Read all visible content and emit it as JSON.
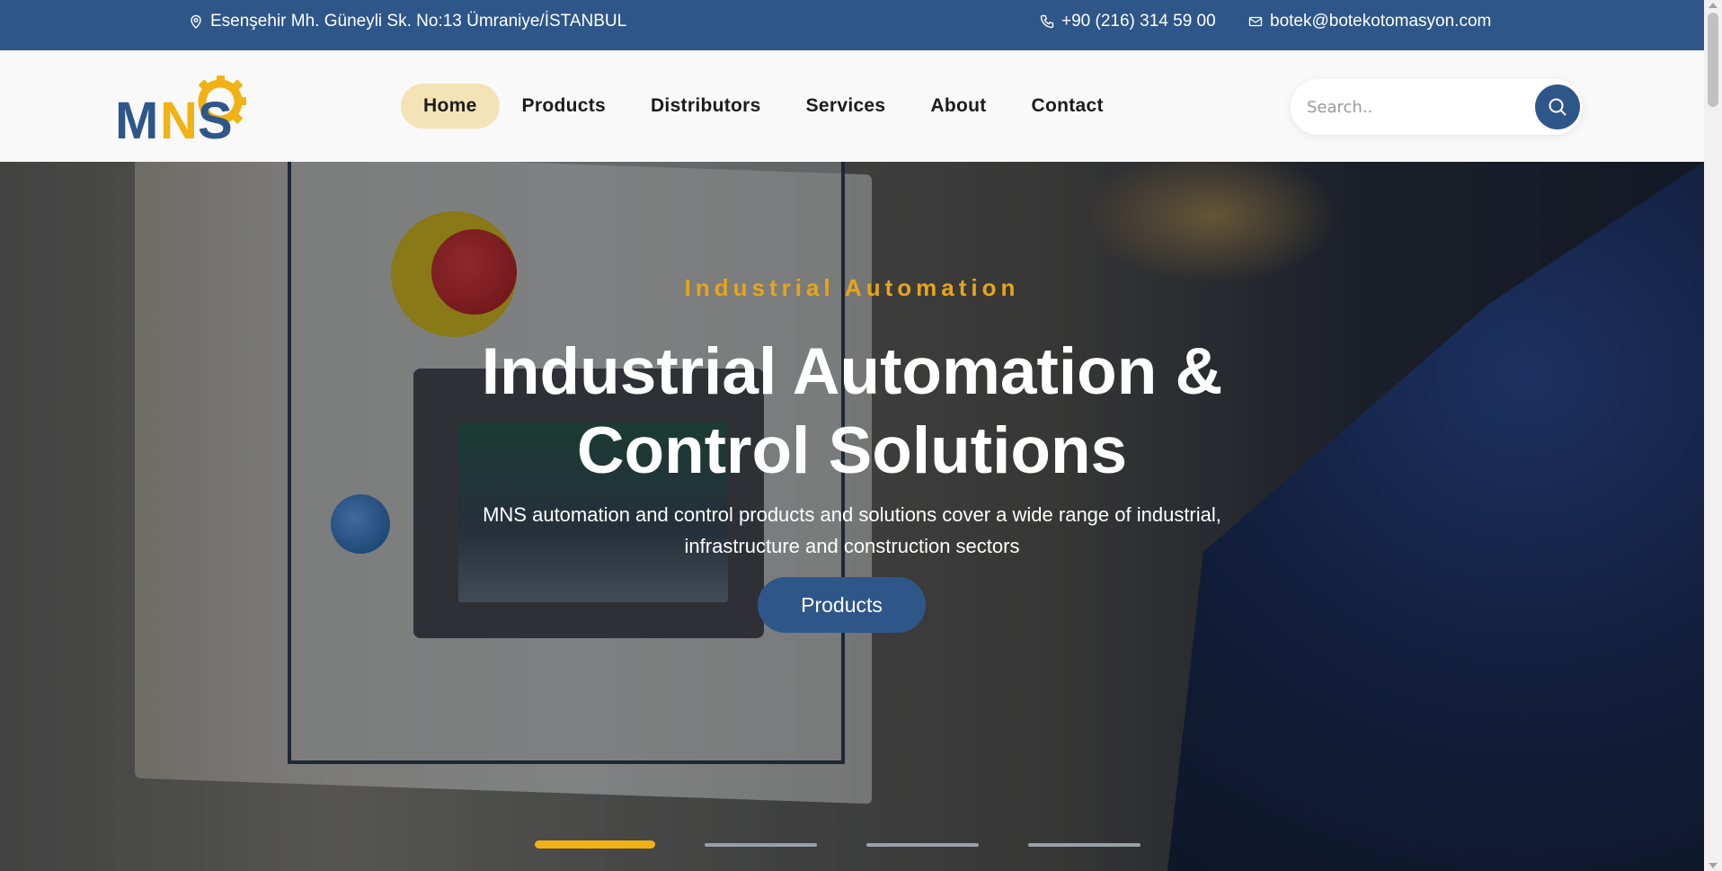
{
  "topbar": {
    "address": "Esenşehir Mh. Güneyli Sk. No:13 Ümraniye/İSTANBUL",
    "phone": "+90 (216) 314 59 00",
    "email": "botek@botekotomasyon.com"
  },
  "logo": {
    "text": "MNS",
    "icon": "gear-icon"
  },
  "nav": {
    "items": [
      "Home",
      "Products",
      "Distributors",
      "Services",
      "About",
      "Contact"
    ],
    "active": "Home"
  },
  "search": {
    "placeholder": "Search..",
    "icon": "search-icon"
  },
  "hero": {
    "eyebrow": "Industrial Automation",
    "title_line1": "Industrial Automation &",
    "title_line2": "Control Solutions",
    "subtitle_line1": "MNS automation and control products and solutions cover a wide range of industrial,",
    "subtitle_line2": "infrastructure and construction sectors",
    "cta_label": "Products",
    "slides_count": 4,
    "active_slide": 1
  },
  "colors": {
    "primary": "#2e5689",
    "accent": "#e8a518",
    "active_nav_bg": "#f3e3b6"
  }
}
